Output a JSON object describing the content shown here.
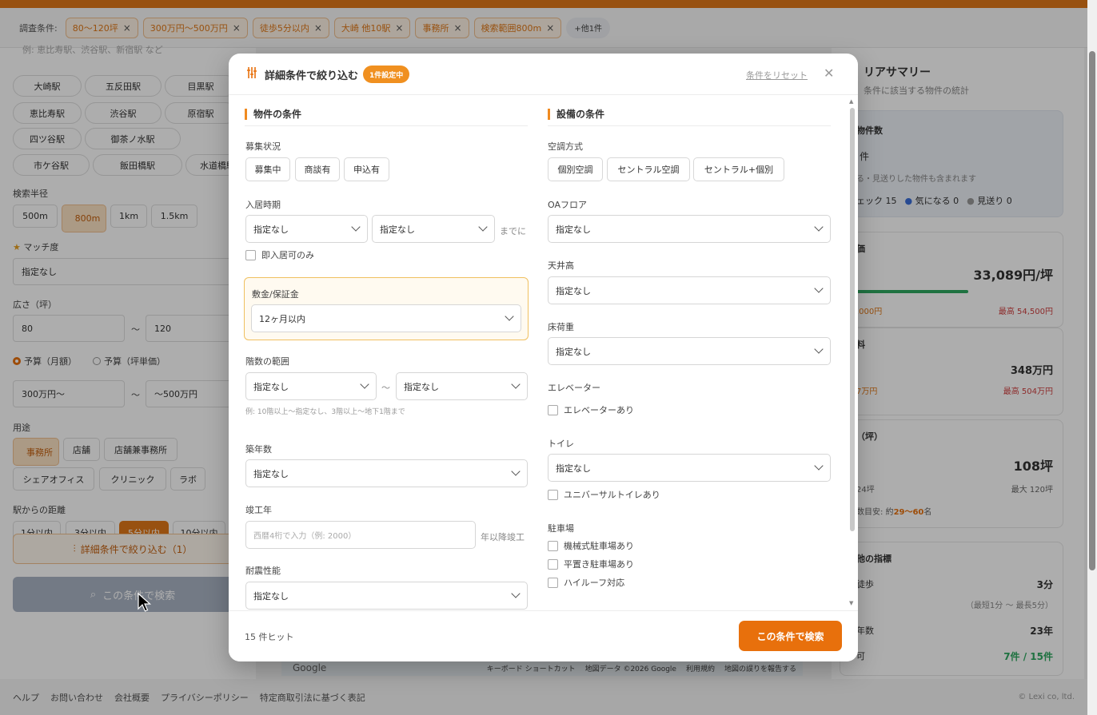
{
  "conditions_bar": {
    "label": "調査条件:",
    "chips": [
      "80〜120坪",
      "300万円〜500万円",
      "徒歩5分以内",
      "大崎 他10駅",
      "事務所",
      "検索範囲800m"
    ],
    "more": "+他1件"
  },
  "left_panel": {
    "station_placeholder": "例: 恵比寿駅、渋谷駅、新宿駅 など",
    "stations": [
      "大崎駅",
      "五反田駅",
      "目黒駅",
      "恵比寿駅",
      "渋谷駅",
      "原宿駅",
      "四ツ谷駅",
      "御茶ノ水駅",
      "市ケ谷駅",
      "飯田橋駅",
      "水道橋駅"
    ],
    "radius_label": "検索半径",
    "radius_options": [
      "500m",
      "800m",
      "1km",
      "1.5km"
    ],
    "match_label": "マッチ度",
    "match_value": "指定なし",
    "area_label": "広さ（坪）",
    "area_min": "80",
    "area_max": "120",
    "range_sep": "〜",
    "budget_monthly": "予算（月額）",
    "budget_tsubo": "予算（坪単価）",
    "budget_min": "300万円〜",
    "budget_max": "〜500万円",
    "usage_label": "用途",
    "usage_options": [
      "事務所",
      "店舗",
      "店舗兼事務所",
      "シェアオフィス",
      "クリニック",
      "ラボ"
    ],
    "distance_label": "駅からの距離",
    "distance_options": [
      "1分以内",
      "3分以内",
      "5分以内",
      "10分以内"
    ],
    "refine_button": "詳細条件で絞り込む（1）",
    "search_button": "この条件で検索"
  },
  "right_panel": {
    "title": "リアサマリー",
    "subtitle": "条件に該当する物件の統計",
    "count_label": "物件数",
    "count_value": "件",
    "count_note": "る・見送りした物件も含まれます",
    "count_check": "ェック 15",
    "count_like": "気になる 0",
    "count_skip": "見送り 0",
    "price_label": "価",
    "price_value": "33,089円/坪",
    "price_min": ",000円",
    "price_max": "最高 54,500円",
    "rent_label": "料",
    "rent_value": "348万円",
    "rent_min": "7万円",
    "rent_max": "最高 504万円",
    "size_label": "（坪）",
    "size_value": "108坪",
    "size_min": "24坪",
    "size_max": "最大 120坪",
    "size_people_prefix": "数目安: 約",
    "size_people_value": "29〜60",
    "size_people_suffix": "名",
    "other_label": "他の指標",
    "walk_label": "徒歩",
    "walk_value": "3分",
    "walk_range": "（最短1分 〜 最長5分）",
    "age_label": "年数",
    "age_value": "23年",
    "match_label": "可",
    "match_value": "7件 / 15件"
  },
  "map_footer": {
    "shortcut": "キーボード ショートカット",
    "data": "地図データ ©2026 Google",
    "terms": "利用規約",
    "report": "地図の誤りを報告する",
    "google": "Google"
  },
  "footer": {
    "links": [
      "ヘルプ",
      "お問い合わせ",
      "会社概要",
      "プライバシーポリシー",
      "特定商取引法に基づく表記"
    ],
    "copyright": "© Lexi co, ltd."
  },
  "modal": {
    "title": "詳細条件で絞り込む",
    "badge": "1件設定中",
    "reset": "条件をリセット",
    "left_heading": "物件の条件",
    "right_heading": "設備の条件",
    "recruit_label": "募集状況",
    "recruit_options": [
      "募集中",
      "商談有",
      "申込有"
    ],
    "movein_label": "入居時期",
    "movein_from": "指定なし",
    "movein_to": "指定なし",
    "movein_suffix": "までに",
    "immediate_label": "即入居可のみ",
    "deposit_label": "敷金/保証金",
    "deposit_value": "12ヶ月以内",
    "floor_label": "階数の範囲",
    "floor_from": "指定なし",
    "floor_to": "指定なし",
    "floor_sep": "〜",
    "floor_note": "例: 10階以上〜指定なし、3階以上〜地下1階まで",
    "age_label": "築年数",
    "age_value": "指定なし",
    "built_label": "竣工年",
    "built_placeholder": "西暦4桁で入力（例: 2000）",
    "built_suffix": "年以降竣工",
    "quake_label": "耐震性能",
    "quake_value": "指定なし",
    "ac_label": "空調方式",
    "ac_options": [
      "個別空調",
      "セントラル空調",
      "セントラル+個別"
    ],
    "oa_label": "OAフロア",
    "oa_value": "指定なし",
    "ceiling_label": "天井高",
    "ceiling_value": "指定なし",
    "load_label": "床荷重",
    "load_value": "指定なし",
    "elevator_label": "エレベーター",
    "elevator_check": "エレベーターあり",
    "toilet_label": "トイレ",
    "toilet_value": "指定なし",
    "toilet_check": "ユニバーサルトイレあり",
    "parking_label": "駐車場",
    "parking_checks": [
      "機械式駐車場あり",
      "平置き駐車場あり",
      "ハイルーフ対応"
    ],
    "hits": "15 件ヒット",
    "submit": "この条件で検索"
  },
  "colors": {
    "accent": "#e8700c",
    "chip_bg": "#fff4e6",
    "highlight_border": "#f0c060"
  }
}
